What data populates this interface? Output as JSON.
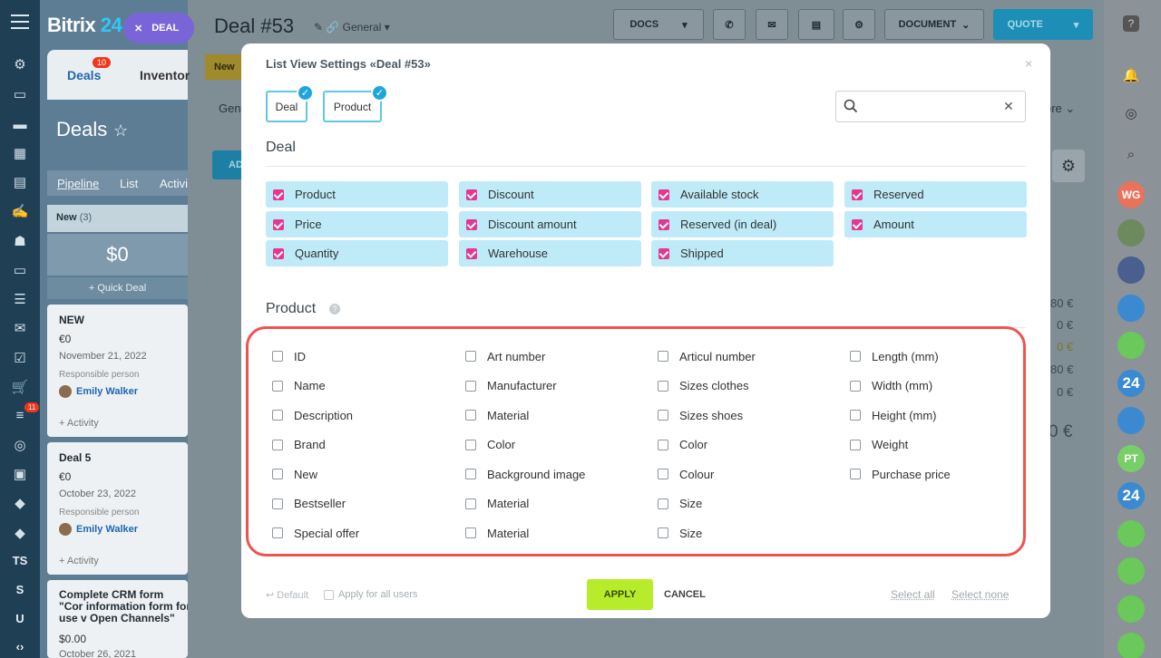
{
  "sidebar": {
    "letters": [
      "TS",
      "S",
      "U"
    ],
    "badge": "11",
    "icons": [
      "grid-icon",
      "list-icon",
      "chat-icon",
      "calendar-icon",
      "document-icon",
      "sign-icon",
      "robot-icon",
      "storage-icon",
      "group-icon",
      "mail-icon",
      "task-icon",
      "cart-icon",
      "filter-icon",
      "target-icon",
      "contact-card-icon",
      "box-icon",
      "box2-icon",
      "code-icon"
    ]
  },
  "crm": {
    "logo": "Bitrix",
    "logo_num": "24",
    "deal_pill": "DEAL",
    "tab_deals": "Deals",
    "tab_deals_badge": "10",
    "tab_inventory": "Inventor",
    "page_title": "Deals",
    "subtabs": [
      "Pipeline",
      "List",
      "Activi"
    ],
    "column_name": "New",
    "column_count": "(3)",
    "column_sum": "$0",
    "quick_deal": "+ Quick Deal",
    "cards": [
      {
        "title": "NEW",
        "value": "€0",
        "date": "November 21, 2022",
        "resp_label": "Responsible person",
        "user": "Emily Walker",
        "activity": "+ Activity"
      },
      {
        "title": "Deal 5",
        "value": "€0",
        "date": "October 23, 2022",
        "resp_label": "Responsible person",
        "user": "Emily Walker",
        "activity": "+ Activity"
      },
      {
        "title": "Complete CRM form \"Cor information form for use v Open Channels\"",
        "value": "$0.00",
        "date": "October 26, 2021"
      }
    ]
  },
  "header": {
    "deal_title": "Deal #53",
    "pipeline": "General",
    "docs": "DOCS",
    "document": "DOCUMENT",
    "quote": "QUOTE",
    "stage": "New",
    "more": "ore",
    "bg_tab": "Gen",
    "bg_btn": "AD"
  },
  "background_values": [
    "80 €",
    "0 €",
    "0 €",
    "80 €",
    "0 €",
    "0 €"
  ],
  "right_rail": {
    "avatars": [
      {
        "text": "WG",
        "color": "#e8735a"
      },
      {
        "text": "",
        "color": "#6d8a5e"
      },
      {
        "text": "",
        "color": "#4a5f8f"
      },
      {
        "text": "",
        "color": "#3b8ad1"
      },
      {
        "text": "",
        "color": "#6bc85a"
      },
      {
        "text": "24",
        "color": "#3b8ad1"
      },
      {
        "text": "",
        "color": "#3b8ad1"
      },
      {
        "text": "PT",
        "color": "#78cf67"
      },
      {
        "text": "24",
        "color": "#3b8ad1"
      },
      {
        "text": "",
        "color": "#6bc85a"
      },
      {
        "text": "",
        "color": "#6bc85a"
      },
      {
        "text": "",
        "color": "#6bc85a"
      },
      {
        "text": "",
        "color": "#6bc85a"
      }
    ]
  },
  "modal": {
    "title": "List View Settings «Deal #53»",
    "tabs": [
      "Deal",
      "Product"
    ],
    "search_placeholder": "",
    "deal_section": "Deal",
    "deal_fields": [
      "Product",
      "Discount",
      "Available stock",
      "Reserved",
      "Price",
      "Discount amount",
      "Reserved (in deal)",
      "Amount",
      "Quantity",
      "Warehouse",
      "Shipped"
    ],
    "product_section": "Product",
    "product_columns": [
      [
        "ID",
        "Name",
        "Description",
        "Brand",
        "New",
        "Bestseller",
        "Special offer"
      ],
      [
        "Art number",
        "Manufacturer",
        "Material",
        "Color",
        "Background image",
        "Material",
        "Material"
      ],
      [
        "Articul number",
        "Sizes clothes",
        "Sizes shoes",
        "Color",
        "Colour",
        "Size",
        "Size"
      ],
      [
        "Length (mm)",
        "Width (mm)",
        "Height (mm)",
        "Weight",
        "Purchase price"
      ]
    ],
    "footer": {
      "default": "Default",
      "apply_all": "Apply for all users",
      "apply": "APPLY",
      "cancel": "CANCEL",
      "select_all": "Select all",
      "select_none": "Select none"
    }
  },
  "colors": {
    "accent_check": "#e6368f",
    "deal_field_bg": "#bfeaf8",
    "apply_btn": "#b7ec2a",
    "highlight": "#ef5350"
  }
}
